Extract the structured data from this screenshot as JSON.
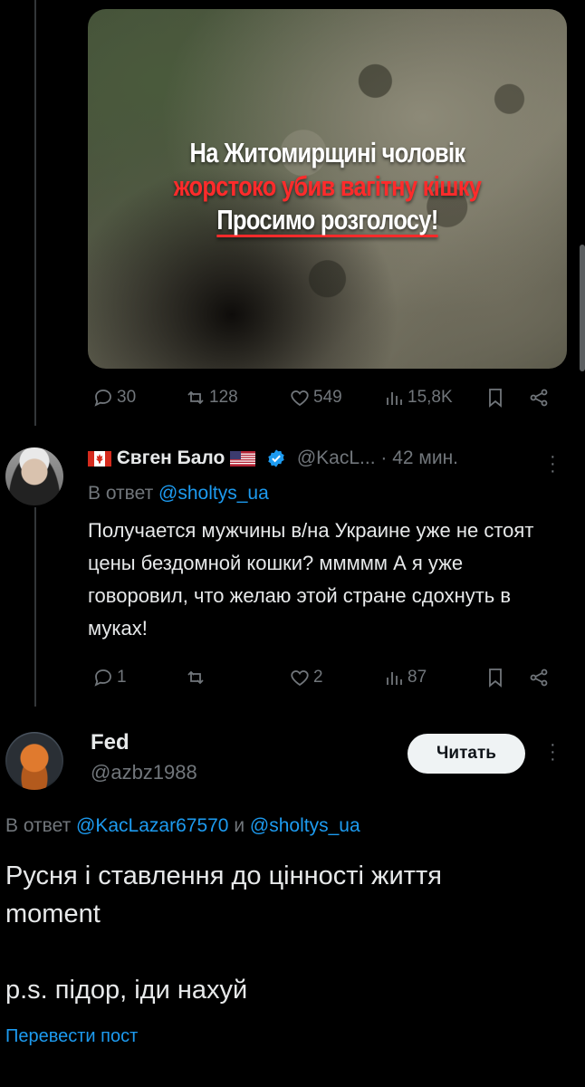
{
  "media": {
    "caption_line1": "На Житомирщині чоловік",
    "caption_line2": "жорстоко убив вагітну кішку",
    "caption_line3": "Просимо розголосу!"
  },
  "tweet1_actions": {
    "replies": "30",
    "reposts": "128",
    "likes": "549",
    "views": "15,8K"
  },
  "reply1": {
    "name": "Євген Бало",
    "handle": "@KacL...",
    "time": "· 42 мин.",
    "reply_prefix": "В ответ",
    "reply_to": "@sholtys_ua",
    "text": "Получается мужчины в/на Украине уже не стоят цены бездомной кошки? ммммм А я уже говоровил, что желаю этой стране сдохнуть в муках!",
    "actions": {
      "replies": "1",
      "likes": "2",
      "views": "87"
    }
  },
  "main_tweet": {
    "name": "Fed",
    "handle": "@azbz1988",
    "follow_label": "Читать",
    "reply_prefix": "В ответ",
    "reply_to_1": "@KacLazar67570",
    "reply_and": "и",
    "reply_to_2": "@sholtys_ua",
    "text_line1": "Русня і ставлення до цінності життя",
    "text_line2": "moment",
    "text_line3": "p.s. підор, іди нахуй",
    "translate_label": "Перевести пост"
  }
}
